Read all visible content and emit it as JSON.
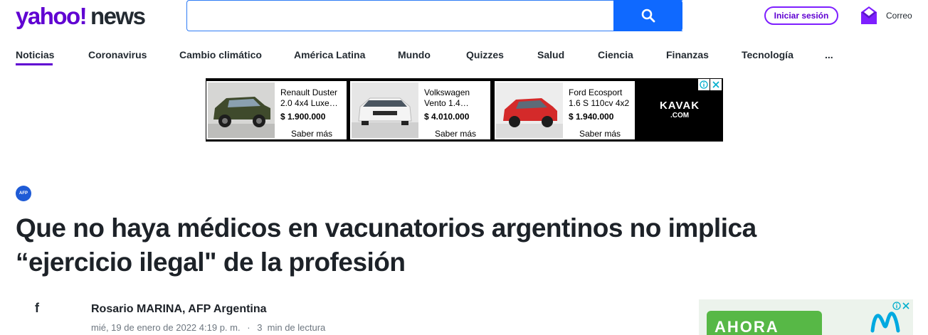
{
  "header": {
    "logo_text": "yahoo!news",
    "search": {
      "placeholder": "",
      "value": ""
    },
    "signin_label": "Iniciar sesión",
    "mail_label": "Correo"
  },
  "nav": {
    "items": [
      {
        "label": "Noticias",
        "active": true
      },
      {
        "label": "Coronavirus"
      },
      {
        "label": "Cambio climático"
      },
      {
        "label": "América Latina"
      },
      {
        "label": "Mundo"
      },
      {
        "label": "Quizzes"
      },
      {
        "label": "Salud"
      },
      {
        "label": "Ciencia"
      },
      {
        "label": "Finanzas"
      },
      {
        "label": "Tecnología"
      },
      {
        "label": "..."
      }
    ]
  },
  "ad": {
    "cards": [
      {
        "title": "Renault Duster 2.0 4x4 Luxe…",
        "price": "$ 1.900.000",
        "cta": "Saber más",
        "image": "car-dark-green-suv"
      },
      {
        "title": "Volkswagen Vento 1.4…",
        "price": "$ 4.010.000",
        "cta": "Saber más",
        "image": "car-white-sedan"
      },
      {
        "title": "Ford Ecosport 1.6 S 110cv 4x2",
        "price": "$ 1.940.000",
        "cta": "Saber más",
        "image": "car-red-suv"
      }
    ],
    "brand": {
      "name": "KAVAK",
      "suffix": ".COM"
    }
  },
  "article": {
    "source_badge": "AFP",
    "headline": "Que no haya médicos en vacunatorios argentinos no implica “ejercicio ilegal\" de la profesión",
    "author": "Rosario MARINA, AFP Argentina",
    "date": "mié, 19 de enero de 2022 4:19 p. m.",
    "separator": "·",
    "read_time": "3  min de lectura",
    "share_icon": "f"
  },
  "side_ad": {
    "text": "AHORA"
  },
  "colors": {
    "brand_purple": "#6001d2",
    "search_blue": "#0f69ff",
    "afp_blue": "#1e5bd6"
  }
}
